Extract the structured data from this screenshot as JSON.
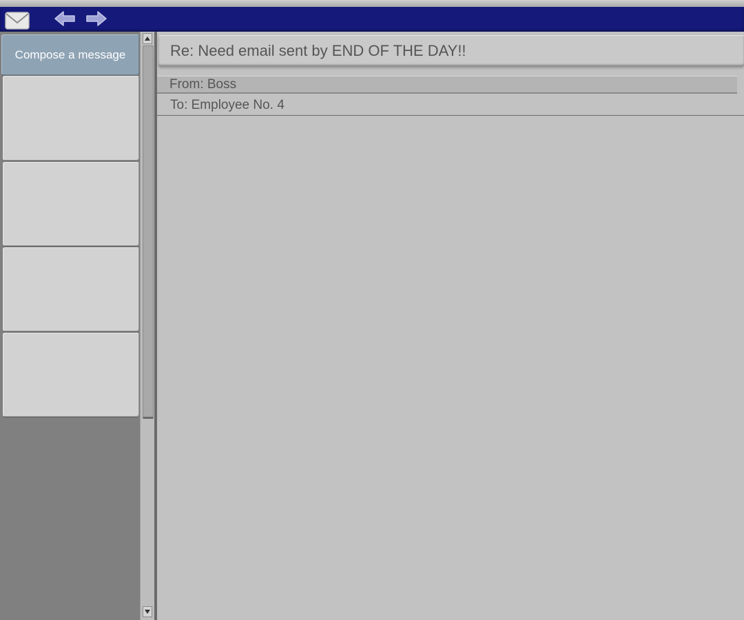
{
  "toolbar": {
    "icons": [
      "mail-icon",
      "arrow-left-icon",
      "arrow-right-icon"
    ],
    "color": "#15197a"
  },
  "sidebar": {
    "compose_label": "Compose a message",
    "compose_color": "#8ea3b4",
    "message_slots": [
      "",
      "",
      "",
      ""
    ]
  },
  "email": {
    "subject": "Re: Need email sent by END OF THE DAY!!",
    "from": "From: Boss",
    "to": "To: Employee No. 4",
    "body": ""
  }
}
